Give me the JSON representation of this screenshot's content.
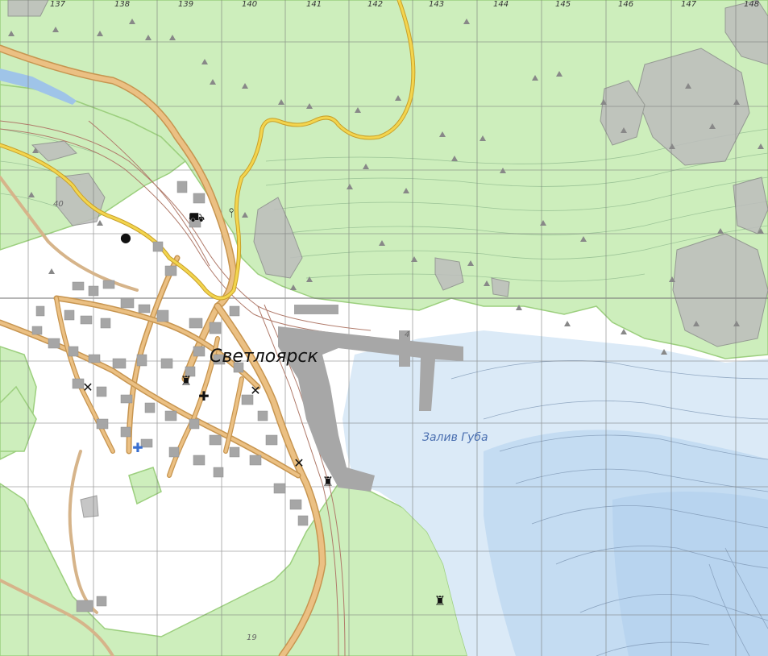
{
  "map": {
    "town_name": "Светлоярск",
    "bay_name": "Залив Губа",
    "grid_columns": [
      "137",
      "138",
      "139",
      "140",
      "141",
      "142",
      "143",
      "144",
      "145",
      "146",
      "147",
      "148"
    ],
    "elevations": [
      "40",
      "19",
      "4"
    ],
    "colors": {
      "forest": "#cdeebc",
      "forest_edge": "#9ccf7e",
      "water": "#cfe3f5",
      "road_main": "#e8b86b",
      "road_yellow": "#f0cf45",
      "building": "#a9a9a9",
      "grid": "#777777"
    },
    "icons": [
      "train-icon",
      "antenna-icon",
      "church-icon",
      "hospital-icon",
      "lighthouse-icon",
      "crossed-tools-icon",
      "factory-icon",
      "well-icon"
    ]
  }
}
